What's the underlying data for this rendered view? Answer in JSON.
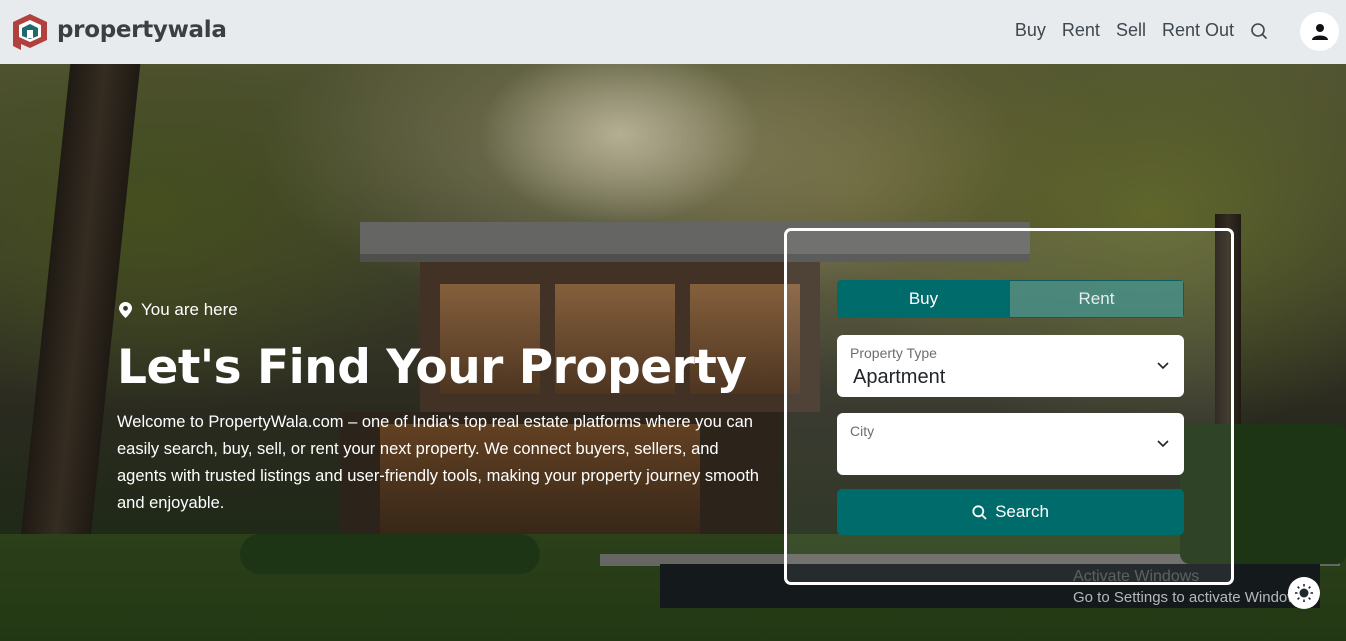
{
  "header": {
    "brand": "propertywala",
    "nav": [
      {
        "label": "Buy"
      },
      {
        "label": "Rent"
      },
      {
        "label": "Sell"
      },
      {
        "label": "Rent Out"
      }
    ],
    "icons": {
      "search": "search-icon",
      "user": "user-icon"
    }
  },
  "hero": {
    "location_label": "You are here",
    "title": "Let's Find Your Property",
    "description": "Welcome to PropertyWala.com – one of India's top real estate platforms where you can easily search, buy, sell, or rent your next property. We connect buyers, sellers, and agents with trusted listings and user-friendly tools, making your property journey smooth and enjoyable."
  },
  "search_panel": {
    "tabs": [
      {
        "label": "Buy",
        "active": true
      },
      {
        "label": "Rent",
        "active": false
      }
    ],
    "property_type": {
      "label": "Property Type",
      "value": "Apartment"
    },
    "city": {
      "label": "City",
      "value": ""
    },
    "search_label": "Search"
  },
  "watermark": {
    "line1": "Activate Windows",
    "line2": "Go to Settings to activate Windows."
  },
  "colors": {
    "accent": "#006b6b",
    "header_bg": "#e8ebee",
    "brand_red": "#b0413e",
    "brand_teal": "#1d6b6b"
  }
}
